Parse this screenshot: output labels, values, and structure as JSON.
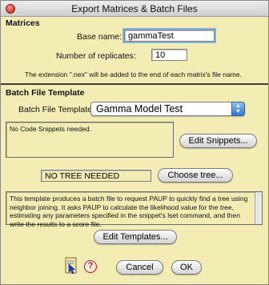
{
  "window": {
    "title": "Export Matrices & Batch Files"
  },
  "matrices": {
    "section_title": "Matrices",
    "base_name_label": "Base name:",
    "base_name_value": "gammaTest",
    "replicates_label": "Number of replicates:",
    "replicates_value": "10",
    "extension_note": "The extension \".nex\" will be added to the end of each matrix's file name."
  },
  "batch": {
    "section_title": "Batch File Template",
    "template_label": "Batch File Template",
    "template_selected": "Gamma Model Test",
    "snippets_text": "No Code Snippets needed.",
    "edit_snippets_button": "Edit Snippets...",
    "tree_value": "NO TREE NEEDED",
    "choose_tree_button": "Choose tree...",
    "description": "This template produces a batch file to request PAUP to quickly find a tree using neighbor joining.  It asks PAUP to calculate the likelihood value for the tree, estimating any parameters specified in the snippet's lset command, and then write the results to a score file.",
    "edit_templates_button": "Edit Templates..."
  },
  "footer": {
    "cancel_button": "Cancel",
    "ok_button": "OK",
    "help_icon_glyph": "?"
  }
}
